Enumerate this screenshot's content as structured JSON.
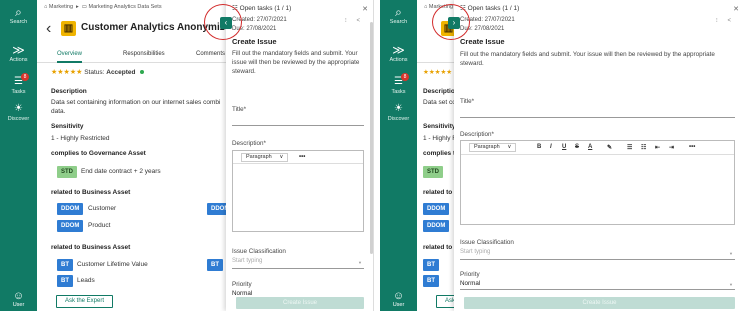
{
  "sidebar": {
    "items": [
      {
        "label": "Search",
        "icon": "search-icon",
        "glyph": "⌕"
      },
      {
        "label": "Actions",
        "icon": "double-chevron-right-icon",
        "glyph": "≫"
      },
      {
        "label": "Tasks",
        "icon": "tasks-icon",
        "glyph": "☰",
        "badge": "8"
      },
      {
        "label": "Discover",
        "icon": "lightbulb-icon",
        "glyph": "☀"
      }
    ],
    "user_label": "User",
    "user_glyph": "☺"
  },
  "asset": {
    "breadcrumb": [
      "Marketing",
      "Marketing Analytics Data Sets"
    ],
    "title": "Customer Analytics Anonymized",
    "tabs": [
      "Overview",
      "Responsibilities",
      "Comments"
    ],
    "stars": "★★★★★",
    "status_label": "Status:",
    "status_value": "Accepted",
    "description_heading": "Description",
    "description_text_1": "Data set containing information on our internet sales combi",
    "description_text_2": "data.",
    "sensitivity_heading": "Sensitivity",
    "sensitivity_value": "1 - Highly Restricted",
    "governance_heading": "complies to Governance Asset",
    "governance_chip": "STD",
    "governance_value": "End date contract + 2 years",
    "business_heading": "related to Business Asset",
    "business_items": [
      {
        "chip": "DDOM",
        "label": "Customer"
      },
      {
        "chip": "DDOM",
        "label": "Product"
      }
    ],
    "business_right_chip": "DDOM",
    "business_heading_2": "related to Business Asset",
    "business_items_2": [
      {
        "chip": "BT",
        "label": "Customer Lifetime Value"
      },
      {
        "chip": "BT",
        "label": "Leads"
      }
    ],
    "business_right_chip_2": "BT",
    "expert_button": "Ask the Expert"
  },
  "task_panel": {
    "header": "Open tasks  (1 / 1)",
    "header_glyph": "☷",
    "close_glyph": "✕",
    "created": "Created: 27/07/2021",
    "due": "Due: 27/08/2021",
    "actions_glyph": "⁝ <",
    "title": "Create Issue",
    "intro_left": "Fill out the mandatory fields and submit. Your issue will then be reviewed by the appropriate steward.",
    "intro_right": "Fill out the mandatory fields and submit. Your issue will then be reviewed by the appropriate steward.",
    "title_field_label": "Title*",
    "description_label": "Description*",
    "paragraph_select": "Paragraph",
    "paragraph_caret": "∨",
    "more_glyph": "•••",
    "toolbar_glyphs": [
      "B",
      "I",
      "U",
      "S",
      "A",
      "✎",
      "☰",
      "☷",
      "⇤",
      "⇥"
    ],
    "classification_label": "Issue Classification",
    "classification_placeholder": "Start typing",
    "priority_label": "Priority",
    "priority_value": "Normal",
    "submit_button": "Create Issue",
    "collapse_left_glyph": "‹",
    "collapse_right_glyph": "›"
  },
  "colors": {
    "brand": "#117a65",
    "annotation_ring": "#d22b2b",
    "chip_blue": "#2f7cd3",
    "chip_green": "#8fce8a",
    "asset_gold": "#f0b400"
  }
}
